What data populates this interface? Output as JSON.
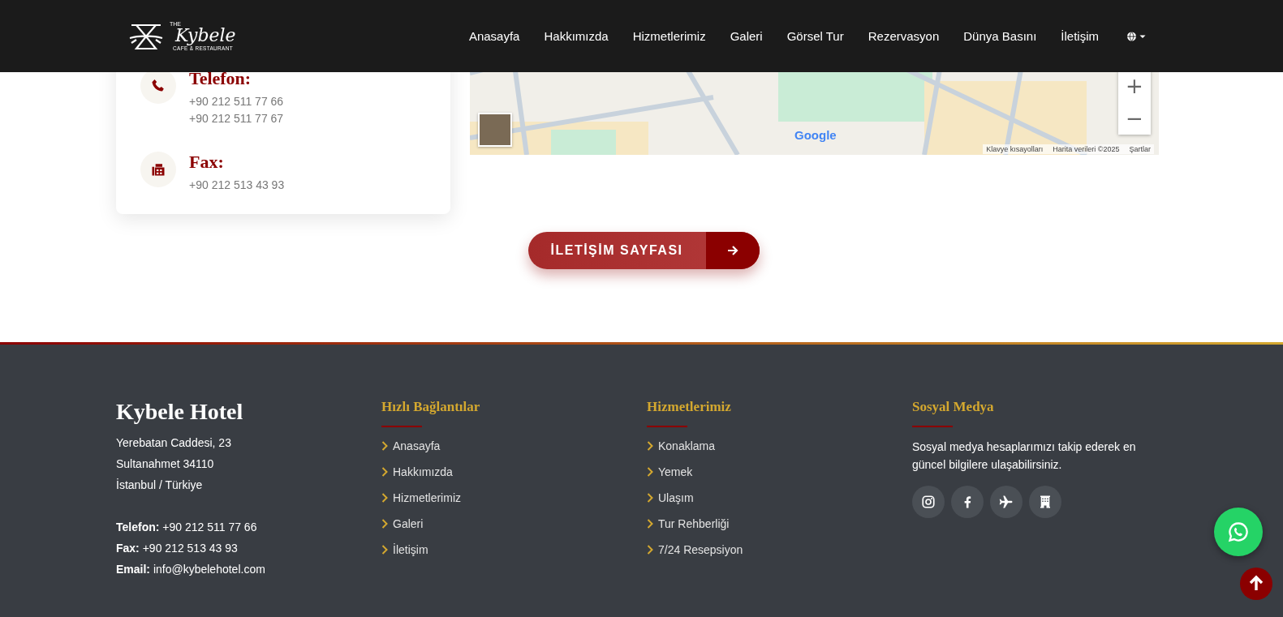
{
  "header": {
    "logo": {
      "small": "THE",
      "name": "Kybele",
      "tagline": "CAFE & RESTAURANT"
    },
    "nav": [
      {
        "label": "Anasayfa",
        "kind": "link"
      },
      {
        "label": "Hakkımızda",
        "kind": "link"
      },
      {
        "label": "Hizmetlerimiz",
        "kind": "link"
      },
      {
        "label": "Galeri",
        "kind": "link"
      },
      {
        "label": "Görsel Tur",
        "kind": "link"
      },
      {
        "label": "Rezervasyon",
        "kind": "link"
      },
      {
        "label": "Dünya Basını",
        "kind": "link"
      },
      {
        "label": "İletişim",
        "kind": "link"
      },
      {
        "kind": "language"
      }
    ]
  },
  "contact_card": [
    {
      "kind": "phone",
      "heading": "Telefon:",
      "lines": [
        "+90 212 511 77 66",
        "+90 212 511 77 67"
      ]
    },
    {
      "kind": "fax",
      "heading": "Fax:",
      "lines": [
        "+90 212 513 43 93"
      ]
    }
  ],
  "map": {
    "logo": "Google",
    "attribution": [
      "Klavye kısayolları",
      "Harita verileri ©2025",
      "Şartlar"
    ],
    "zoom_controls": [
      "+",
      "−"
    ]
  },
  "contact_button": {
    "label": "İLETİŞİM SAYFASI"
  },
  "footer": {
    "title": "Kybele Hotel",
    "address": [
      "Yerebatan Caddesi, 23",
      "Sultanahmet 34110",
      "İstanbul / Türkiye"
    ],
    "contacts": [
      "**Telefon:** +90 212 511 77 66",
      "**Fax:** +90 212 513 43 93",
      "**Email:** info@kybelehotel.com"
    ],
    "quick_links": {
      "heading": "Hızlı Bağlantılar",
      "items": [
        "Anasayfa",
        "Hakkımızda",
        "Hizmetlerimiz",
        "Galeri",
        "İletişim"
      ]
    },
    "services": {
      "heading": "Hizmetlerimiz",
      "items": [
        "Konaklama",
        "Yemek",
        "Ulaşım",
        "Tur Rehberliği",
        "7/24 Resepsiyon"
      ]
    },
    "social": {
      "heading": "Sosyal Medya",
      "text": "Sosyal medya hesaplarımızı takip ederek en güncel bilgilere ulaşabilirsiniz.",
      "icons": [
        {
          "kind": "instagram"
        },
        {
          "kind": "facebook"
        },
        {
          "kind": "plane"
        },
        {
          "kind": "building"
        }
      ]
    }
  },
  "floating": [
    {
      "kind": "whatsapp"
    },
    {
      "kind": "top"
    }
  ]
}
